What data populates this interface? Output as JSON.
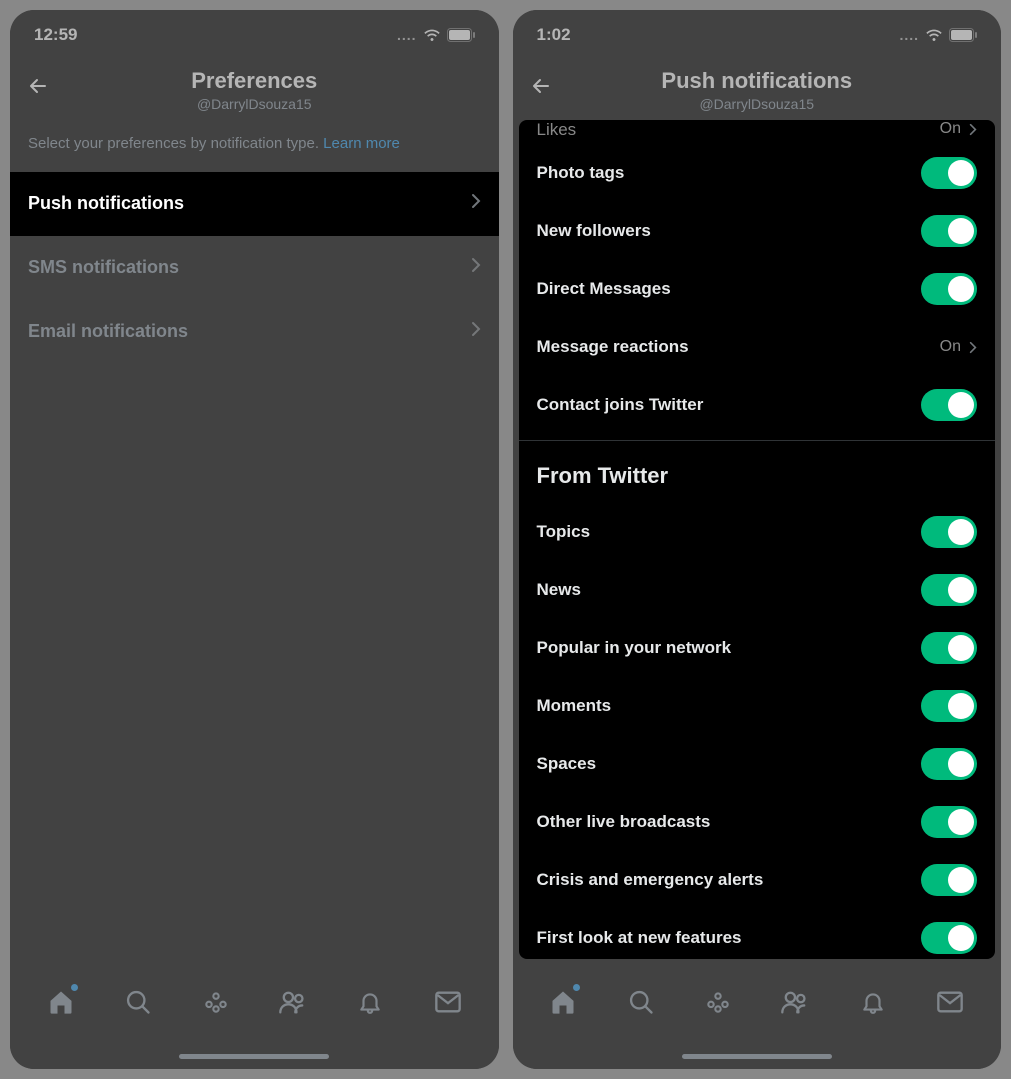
{
  "left": {
    "time": "12:59",
    "title": "Preferences",
    "subtitle": "@DarrylDsouza15",
    "descriptionText": "Select your preferences by notification type. ",
    "learnMore": "Learn more",
    "rows": [
      {
        "label": "Push notifications"
      },
      {
        "label": "SMS notifications"
      },
      {
        "label": "Email notifications"
      }
    ]
  },
  "right": {
    "time": "1:02",
    "title": "Push notifications",
    "subtitle": "@DarrylDsouza15",
    "likesRow": {
      "label": "Likes",
      "value": "On"
    },
    "relatedRows": [
      {
        "label": "Photo tags",
        "type": "toggle",
        "on": true
      },
      {
        "label": "New followers",
        "type": "toggle",
        "on": true
      },
      {
        "label": "Direct Messages",
        "type": "toggle",
        "on": true
      },
      {
        "label": "Message reactions",
        "type": "value",
        "value": "On"
      },
      {
        "label": "Contact joins Twitter",
        "type": "toggle",
        "on": true
      }
    ],
    "sectionHeader": "From Twitter",
    "fromTwitterRows": [
      {
        "label": "Topics",
        "on": true
      },
      {
        "label": "News",
        "on": true
      },
      {
        "label": "Popular in your network",
        "on": true
      },
      {
        "label": "Moments",
        "on": true
      },
      {
        "label": "Spaces",
        "on": true
      },
      {
        "label": "Other live broadcasts",
        "on": true
      },
      {
        "label": "Crisis and emergency alerts",
        "on": true
      },
      {
        "label": "First look at new features",
        "on": true
      }
    ]
  },
  "colors": {
    "accent": "#1d9bf0",
    "toggleOn": "#00ba7c"
  }
}
